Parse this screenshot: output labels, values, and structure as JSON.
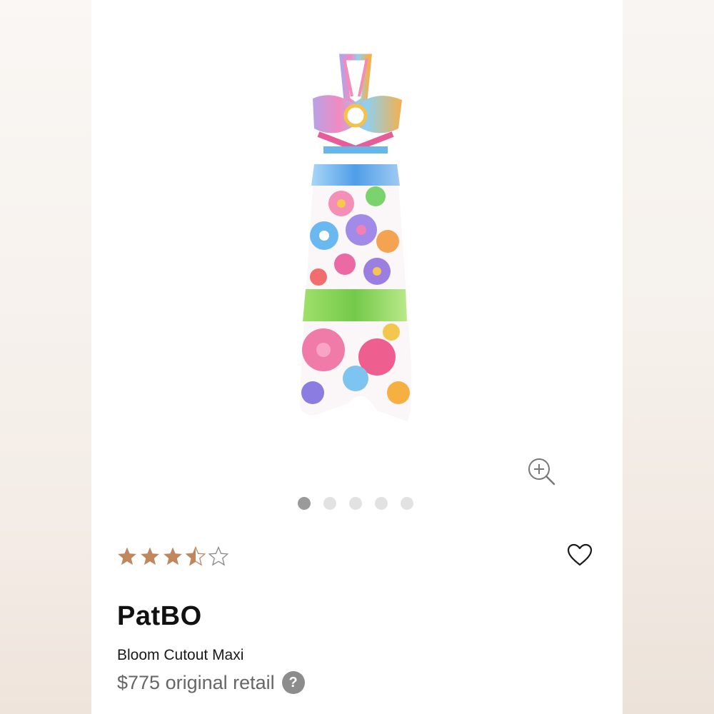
{
  "product": {
    "brand": "PatBO",
    "name": "Bloom Cutout Maxi",
    "price": "$775 original retail",
    "help_icon_label": "?",
    "image_icon": "floral-maxi-dress-image"
  },
  "carousel": {
    "total_images": 5,
    "active_index": 0
  },
  "rating": {
    "value": 3.5,
    "max": 5,
    "star_color": "#c0875e"
  },
  "icons": {
    "zoom": "zoom-in-icon",
    "favorite": "heart-icon",
    "help": "question-mark-icon"
  }
}
